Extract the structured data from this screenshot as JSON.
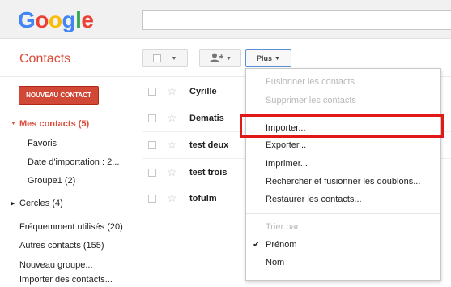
{
  "brand": {
    "letters": [
      {
        "char": "G",
        "color": "#4285f4"
      },
      {
        "char": "o",
        "color": "#ea4335"
      },
      {
        "char": "o",
        "color": "#fbbc05"
      },
      {
        "char": "g",
        "color": "#4285f4"
      },
      {
        "char": "l",
        "color": "#34a853"
      },
      {
        "char": "e",
        "color": "#ea4335"
      }
    ]
  },
  "app_title": "Contacts",
  "toolbar": {
    "more_label": "Plus",
    "select_icon": "checkbox-icon",
    "add_person_icon": "add-person-icon"
  },
  "sidebar": {
    "new_contact_label": "NOUVEAU CONTACT",
    "my_contacts": "Mes contacts (5)",
    "favorites": "Favoris",
    "import_date": "Date d'importation : 2...",
    "group1": "Groupe1 (2)",
    "circles": "Cercles (4)",
    "frequent": "Fréquemment utilisés (20)",
    "other_contacts": "Autres contacts (155)",
    "new_group": "Nouveau groupe...",
    "import_contacts": "Importer des contacts..."
  },
  "contacts": [
    {
      "name": "Cyrille",
      "extra": "1"
    },
    {
      "name": "Dematis",
      "extra": ""
    },
    {
      "name": "test deux",
      "extra": ""
    },
    {
      "name": "test trois",
      "extra": ""
    },
    {
      "name": "tofulm",
      "extra": ""
    }
  ],
  "menu": {
    "merge": "Fusionner les contacts",
    "delete": "Supprimer les contacts",
    "import": "Importer...",
    "export": "Exporter...",
    "print": "Imprimer...",
    "find_merge": "Rechercher et fusionner les doublons...",
    "restore": "Restaurer les contacts...",
    "sort_by": "Trier par",
    "first_name": "Prénom",
    "last_name": "Nom"
  },
  "colors": {
    "accent_red": "#dd4b39",
    "highlight": "#e01818"
  }
}
